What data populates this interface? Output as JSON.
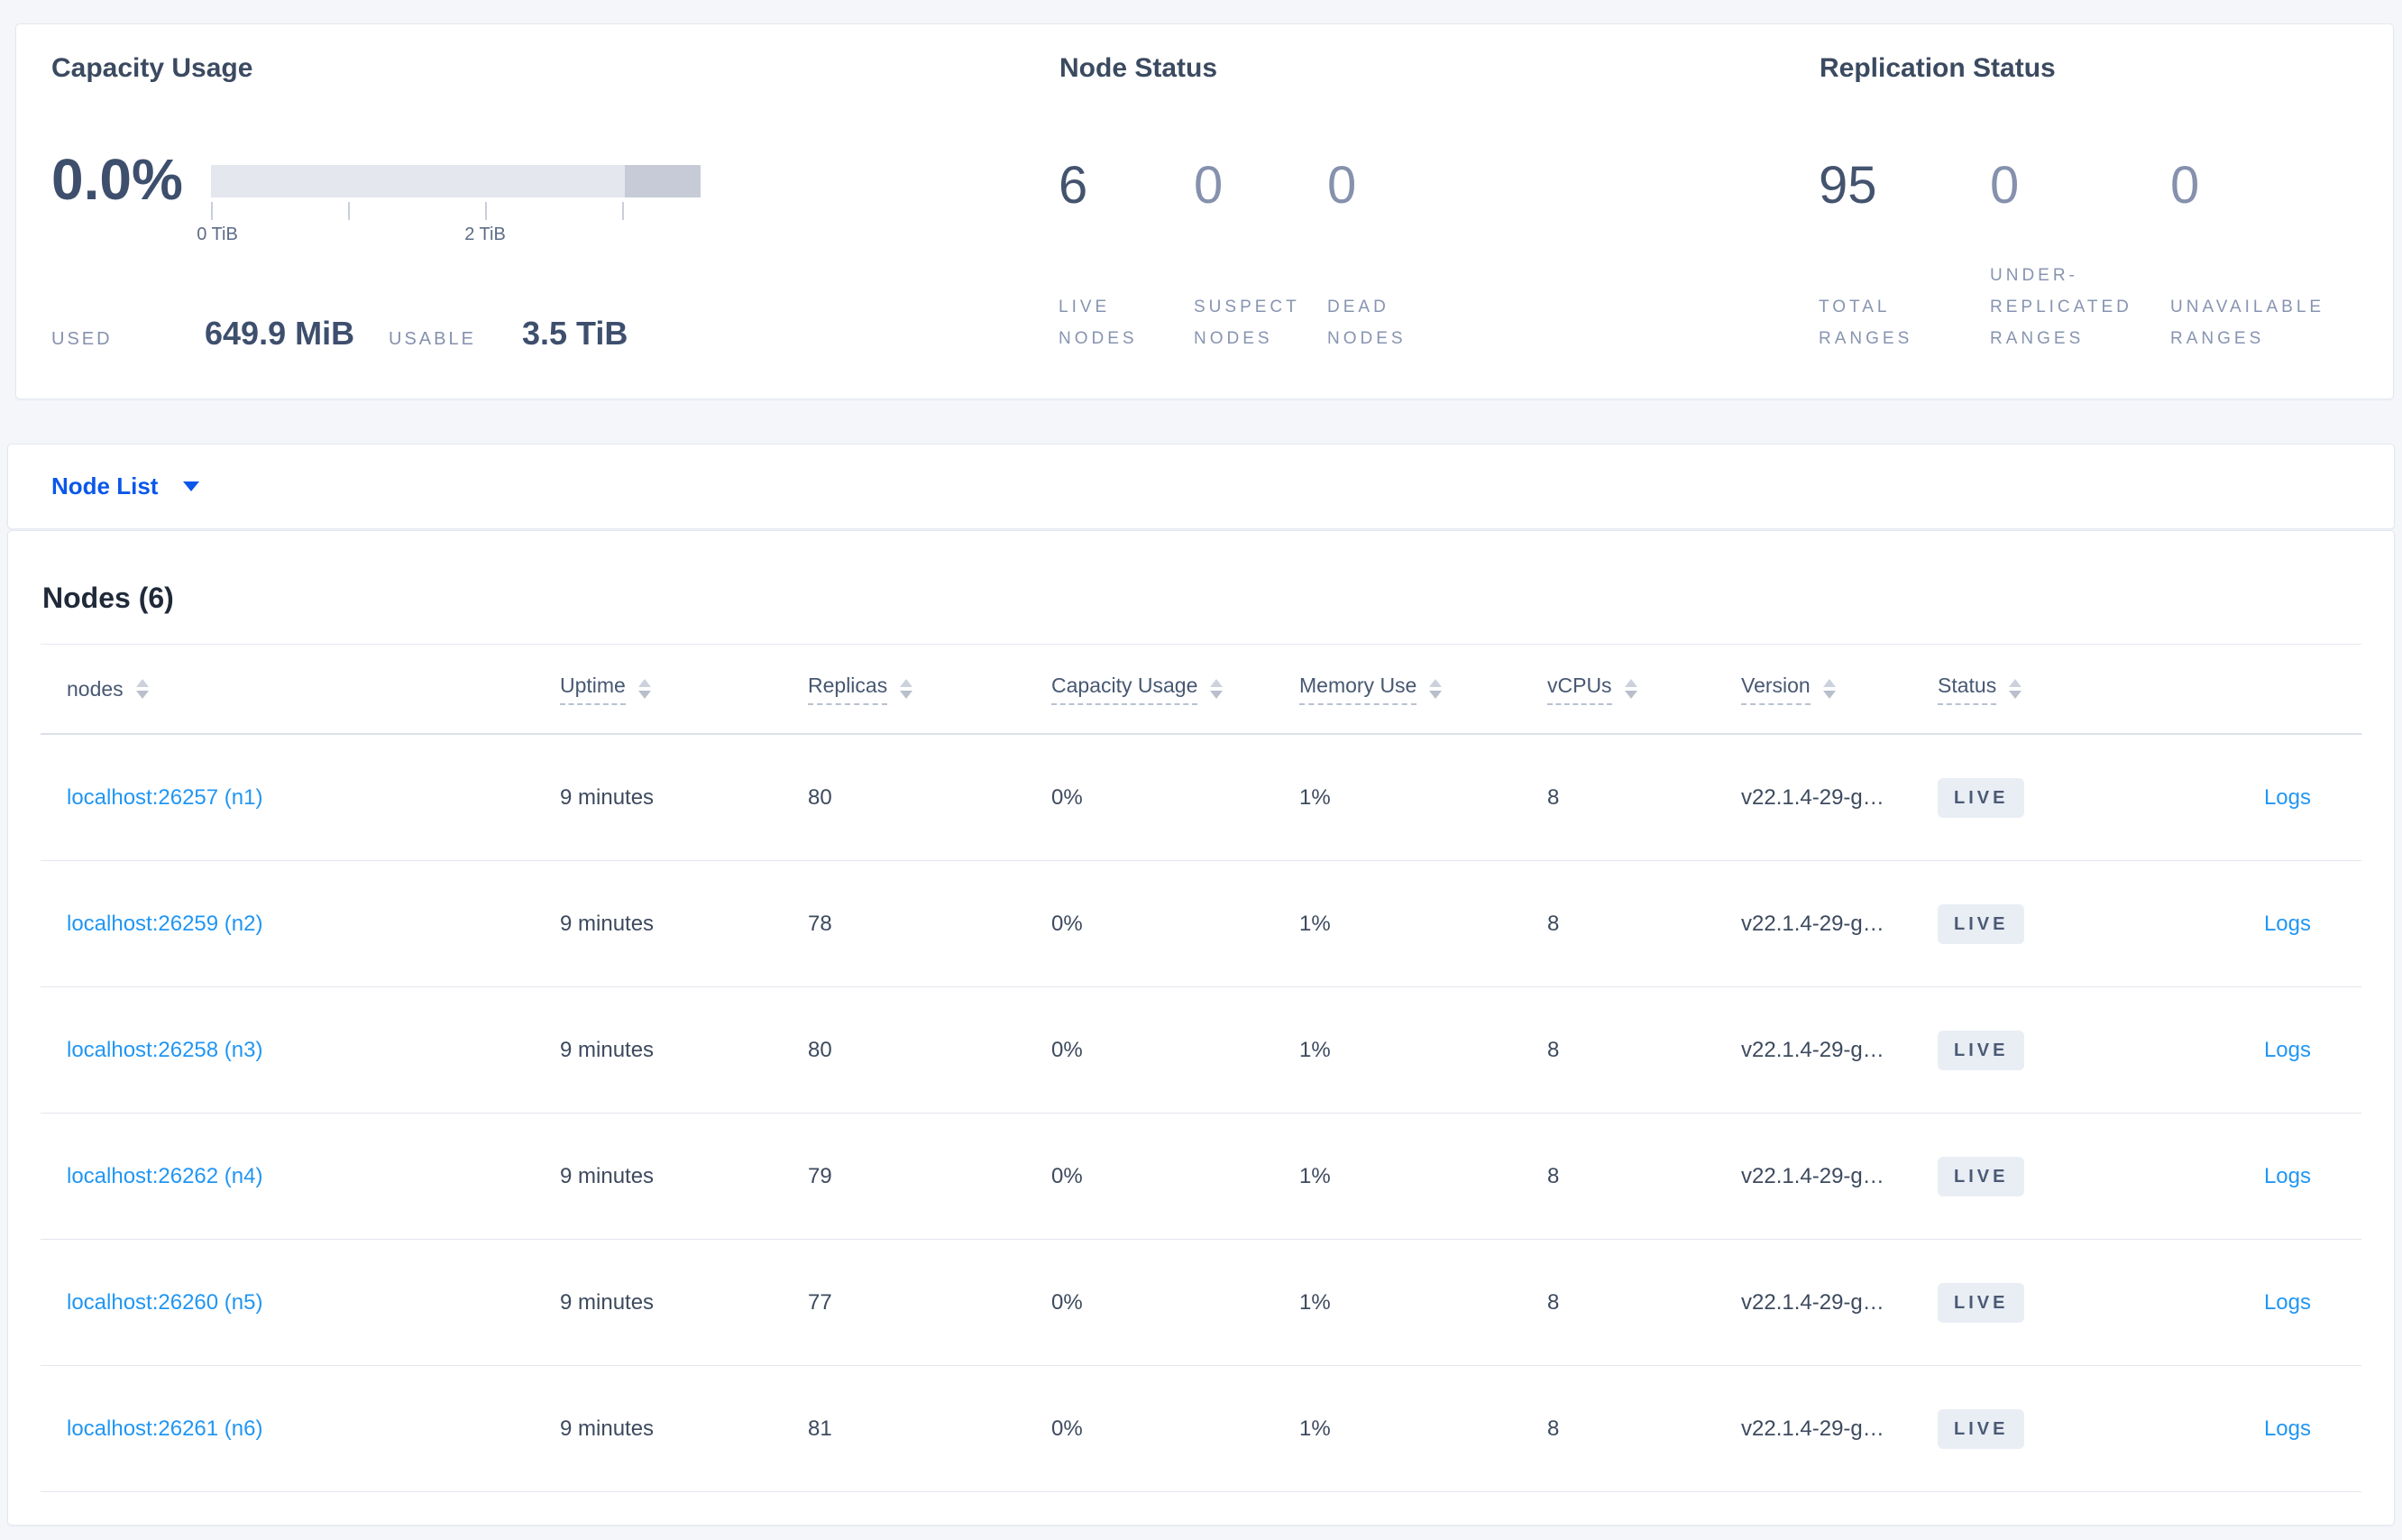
{
  "colors": {
    "link_blue": "#2196f3",
    "selector_blue": "#0b57ea",
    "badge_bg": "#e9edf4",
    "badge_text": "#4a5a75",
    "bar_track": "#e4e7ee",
    "bar_segment": "#c6cbd7"
  },
  "summary": {
    "capacity": {
      "title": "Capacity Usage",
      "percent": "0.0%",
      "tick_start": "0 TiB",
      "tick_mid": "2 TiB",
      "used_label": "USED",
      "used_value": "649.9 MiB",
      "usable_label": "USABLE",
      "usable_value": "3.5 TiB"
    },
    "node_status": {
      "title": "Node Status",
      "stats": [
        {
          "value": "6",
          "label_lines": [
            "LIVE",
            "NODES"
          ],
          "emph": true
        },
        {
          "value": "0",
          "label_lines": [
            "SUSPECT",
            "NODES"
          ],
          "emph": false
        },
        {
          "value": "0",
          "label_lines": [
            "DEAD",
            "NODES"
          ],
          "emph": false
        }
      ]
    },
    "replication": {
      "title": "Replication Status",
      "stats": [
        {
          "value": "95",
          "label_lines": [
            "TOTAL",
            "RANGES"
          ],
          "emph": true
        },
        {
          "value": "0",
          "label_lines": [
            "UNDER-",
            "REPLICATED",
            "RANGES"
          ],
          "emph": false
        },
        {
          "value": "0",
          "label_lines": [
            "UNAVAILABLE",
            "RANGES"
          ],
          "emph": false
        }
      ]
    }
  },
  "view_selector": {
    "label": "Node List"
  },
  "nodes_section": {
    "title": "Nodes (6)",
    "columns": [
      {
        "label": "nodes",
        "key": "address",
        "underline": false
      },
      {
        "label": "Uptime",
        "key": "uptime",
        "underline": true
      },
      {
        "label": "Replicas",
        "key": "replicas",
        "underline": true
      },
      {
        "label": "Capacity Usage",
        "key": "capacity",
        "underline": true
      },
      {
        "label": "Memory Use",
        "key": "memory",
        "underline": true
      },
      {
        "label": "vCPUs",
        "key": "vcpus",
        "underline": true
      },
      {
        "label": "Version",
        "key": "version",
        "underline": true
      },
      {
        "label": "Status",
        "key": "status",
        "underline": true
      },
      {
        "label": "",
        "key": "logs",
        "underline": false
      }
    ],
    "rows": [
      {
        "address": "localhost:26257 (n1)",
        "uptime": "9 minutes",
        "replicas": "80",
        "capacity": "0%",
        "memory": "1%",
        "vcpus": "8",
        "version": "v22.1.4-29-g…",
        "status": "LIVE",
        "logs": "Logs"
      },
      {
        "address": "localhost:26259 (n2)",
        "uptime": "9 minutes",
        "replicas": "78",
        "capacity": "0%",
        "memory": "1%",
        "vcpus": "8",
        "version": "v22.1.4-29-g…",
        "status": "LIVE",
        "logs": "Logs"
      },
      {
        "address": "localhost:26258 (n3)",
        "uptime": "9 minutes",
        "replicas": "80",
        "capacity": "0%",
        "memory": "1%",
        "vcpus": "8",
        "version": "v22.1.4-29-g…",
        "status": "LIVE",
        "logs": "Logs"
      },
      {
        "address": "localhost:26262 (n4)",
        "uptime": "9 minutes",
        "replicas": "79",
        "capacity": "0%",
        "memory": "1%",
        "vcpus": "8",
        "version": "v22.1.4-29-g…",
        "status": "LIVE",
        "logs": "Logs"
      },
      {
        "address": "localhost:26260 (n5)",
        "uptime": "9 minutes",
        "replicas": "77",
        "capacity": "0%",
        "memory": "1%",
        "vcpus": "8",
        "version": "v22.1.4-29-g…",
        "status": "LIVE",
        "logs": "Logs"
      },
      {
        "address": "localhost:26261 (n6)",
        "uptime": "9 minutes",
        "replicas": "81",
        "capacity": "0%",
        "memory": "1%",
        "vcpus": "8",
        "version": "v22.1.4-29-g…",
        "status": "LIVE",
        "logs": "Logs"
      }
    ]
  }
}
